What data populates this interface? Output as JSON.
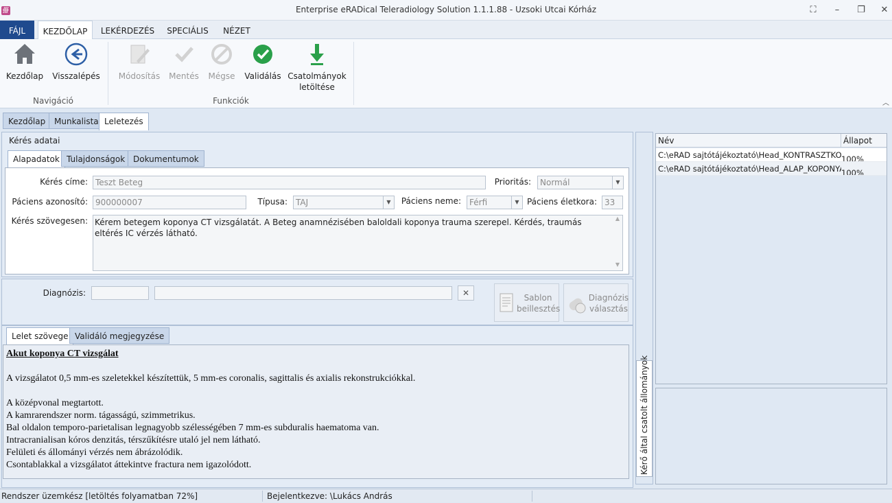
{
  "window": {
    "title": "Enterprise eRADical Teleradiology Solution 1.1.1.88 - Uzsoki Utcai Kórház",
    "app_icon_glyph": "∰"
  },
  "menu": {
    "file": "FÁJL",
    "tabs": [
      "KEZDŐLAP",
      "LEKÉRDEZÉS",
      "SPECIÁLIS",
      "NÉZET"
    ]
  },
  "ribbon": {
    "home": "Kezdőlap",
    "back": "Visszalépés",
    "group_nav": "Navigáció",
    "modify": "Módosítás",
    "save": "Mentés",
    "cancel": "Mégse",
    "validate": "Validálás",
    "attachments_1": "Csatolmányok",
    "attachments_2": "letöltése",
    "group_func": "Funkciók"
  },
  "doc_tabs": [
    "Kezdőlap",
    "Munkalista",
    "Leletezés"
  ],
  "request": {
    "section_title": "Kérés adatai",
    "tabs": [
      "Alapadatok",
      "Tulajdonságok",
      "Dokumentumok"
    ],
    "title_label": "Kérés címe:",
    "title_value": "Teszt Beteg",
    "priority_label": "Prioritás:",
    "priority_value": "Normál",
    "patient_id_label": "Páciens azonosító:",
    "patient_id_value": "900000007",
    "type_label": "Típusa:",
    "type_value": "TAJ",
    "patient_name_label": "Páciens neme:",
    "patient_name_value": "Férfi",
    "age_label": "Páciens életkora:",
    "age_value": "33",
    "text_label": "Kérés szövegesen:",
    "text_value": "Kérem betegem koponya CT vizsgálatát. A Beteg anamnézisében baloldali koponya trauma szerepel. Kérdés, traumás eltérés IC vérzés látható."
  },
  "diagnosis": {
    "label": "Diagnózis:",
    "template_btn_1": "Sablon",
    "template_btn_2": "beillesztés",
    "diag_btn_1": "Diagnózis",
    "diag_btn_2": "választás"
  },
  "report_tabs": [
    "Lelet szövege",
    "Validáló megjegyzése"
  ],
  "report": {
    "heading": "Akut koponya CT vizsgálat",
    "lines": [
      "A vizsgálatot 0,5 mm-es szeletekkel készítettük, 5 mm-es coronalis, sagittalis és axialis rekonstrukciókkal.",
      "",
      "A középvonal megtartott.",
      "A kamrarendszer norm. tágasságú, szimmetrikus.",
      "Bal oldalon temporo-parietalisan legnagyobb szélességében 7 mm-es subduralis haematoma van.",
      "Intracranialisan kóros denzitás, térszűkítésre utaló jel nem látható.",
      "Felületi és állományi vérzés nem ábrázolódik.",
      "Csontablakkal a vizsgálatot áttekintve fractura nem igazolódott."
    ]
  },
  "attachments": {
    "side_label": "Kérő által csatolt állományok",
    "col_name": "Név",
    "col_status": "Állapot",
    "rows": [
      {
        "name": "C:\\eRAD sajtótájékoztató\\Head_KONTRASZTKOF",
        "status": "100%"
      },
      {
        "name": "C:\\eRAD sajtótájékoztató\\Head_ALAP_KOPONYA",
        "status": "100%"
      }
    ]
  },
  "status": {
    "left": "Rendszer üzemkész [letöltés folyamatban 72%]",
    "right": "Bejelentkezve: \\Lukács András"
  }
}
